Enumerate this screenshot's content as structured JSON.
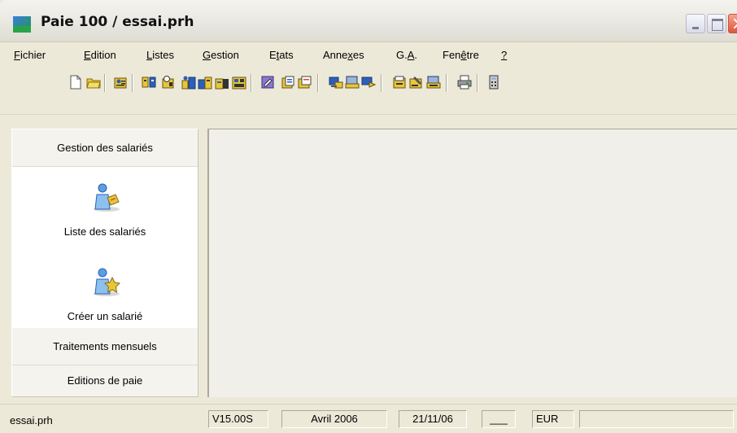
{
  "window": {
    "title": "Paie 100 / essai.prh"
  },
  "menu": [
    {
      "label": "Fichier",
      "accel": "F",
      "rest": "ichier"
    },
    {
      "label": "Edition",
      "accel": "E",
      "rest": "dition"
    },
    {
      "label": "Listes",
      "accel": "L",
      "rest": "istes"
    },
    {
      "label": "Gestion",
      "accel": "G",
      "rest": "estion"
    },
    {
      "label": "Etats",
      "pre": "E",
      "accel": "t",
      "rest": "ats"
    },
    {
      "label": "Annexes",
      "pre": "Anne",
      "accel": "x",
      "rest": "es"
    },
    {
      "label": "G.A.",
      "pre": "G.",
      "accel": "A",
      "rest": "."
    },
    {
      "label": "Fenêtre",
      "pre": "Fen",
      "accel": "ê",
      "rest": "tre"
    },
    {
      "label": "?",
      "accel": "?",
      "rest": ""
    }
  ],
  "toolbar_icons": [
    "new-document-icon",
    "open-folder-icon",
    "employee-sheet-icon",
    "employees-icon",
    "search-employee-icon",
    "building-icon-1",
    "building-icon-2",
    "building-icon-3",
    "building-icon-4",
    "edit-record-icon",
    "report-icon-1",
    "report-icon-2",
    "computer-icon-1",
    "computer-icon-2",
    "computer-icon-3",
    "archive-icon-1",
    "archive-icon-2",
    "archive-icon-3",
    "print-icon",
    "calculator-icon"
  ],
  "left_panel": {
    "sections": {
      "gestion_salaries": "Gestion des salariés",
      "traitements_mensuels": "Traitements mensuels",
      "editions_de_paie": "Editions de paie"
    },
    "items": [
      {
        "label": "Liste des salariés",
        "icon": "employee-list-icon"
      },
      {
        "label": "Créer un salarié",
        "icon": "create-employee-icon"
      }
    ]
  },
  "status_bar": {
    "file": "essai.prh",
    "version": "V15.00S",
    "period": "Avril 2006",
    "date": "21/11/06",
    "blank": "___",
    "currency": "EUR"
  },
  "colors": {
    "chrome": "#ece9d8",
    "close_button": "#e0563a",
    "icon_blue": "#2c5fb8",
    "icon_yellow": "#e7c63a"
  }
}
